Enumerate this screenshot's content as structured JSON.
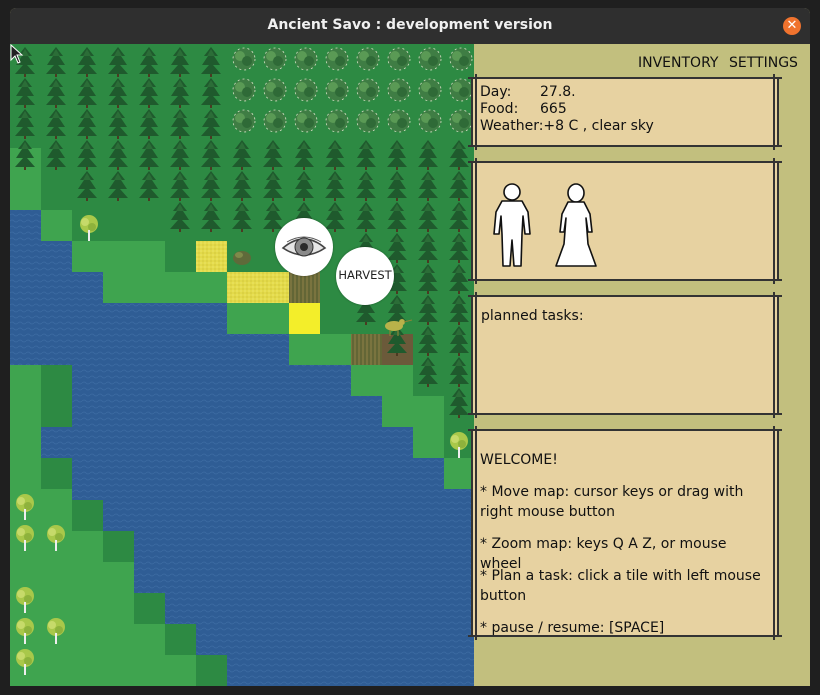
{
  "window": {
    "title": "Ancient Savo : development version"
  },
  "map": {
    "bubbles": {
      "look_icon": "eye-icon",
      "harvest_label": "HARVEST"
    }
  },
  "menu": {
    "inventory": "INVENTORY",
    "settings": "SETTINGS"
  },
  "stats": {
    "day_label": "Day:",
    "day_value": "27.8.",
    "food_label": "Food:",
    "food_value": "665",
    "weather_label": "Weather:",
    "weather_value": "+8 C , clear sky"
  },
  "characters": [
    "male-figure-icon",
    "female-figure-icon"
  ],
  "tasks": {
    "title": "planned tasks:"
  },
  "welcome": {
    "heading": "WELCOME!",
    "lines": [
      "* Move map: cursor keys or drag with right mouse button",
      "* Zoom map: keys Q A Z, or mouse wheel",
      "* Plan a task: click a tile with left mouse button",
      "* pause / resume: [SPACE]"
    ]
  },
  "colors": {
    "forest": "#2f7a3c",
    "grass": "#3fa44f",
    "water": "#2f5d95",
    "panel": "#e7d2a1",
    "panel_border": "#3a3a3a",
    "side_bg": "#c2bf7e",
    "field_yellow": "#e8e04a"
  }
}
